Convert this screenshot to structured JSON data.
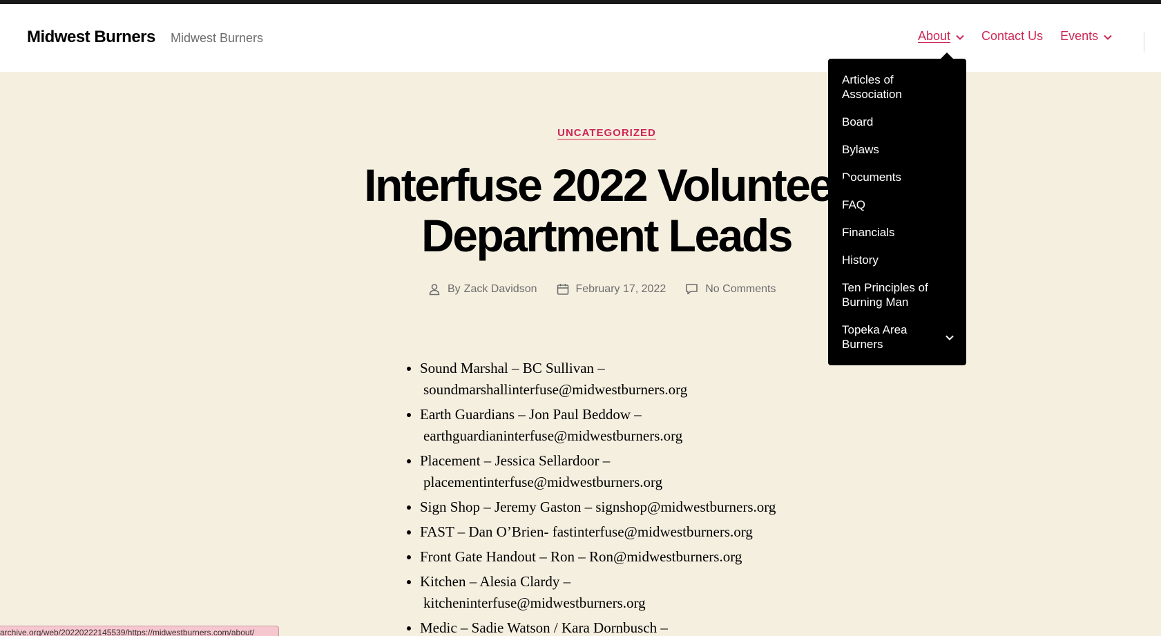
{
  "site": {
    "title": "Midwest Burners",
    "description": "Midwest Burners"
  },
  "nav": {
    "items": [
      {
        "label": "About",
        "has_submenu": true
      },
      {
        "label": "Contact Us",
        "has_submenu": false
      },
      {
        "label": "Events",
        "has_submenu": true
      }
    ]
  },
  "about_submenu": {
    "items": [
      {
        "label": "Articles of Association"
      },
      {
        "label": "Board"
      },
      {
        "label": "Bylaws"
      },
      {
        "label": "Documents"
      },
      {
        "label": "FAQ"
      },
      {
        "label": "Financials"
      },
      {
        "label": "History"
      },
      {
        "label": "Ten Principles of Burning Man"
      },
      {
        "label": "Topeka Area Burners"
      }
    ]
  },
  "post": {
    "category": "UNCATEGORIZED",
    "title_line1": "Interfuse 2022 Volunteer",
    "title_line2": "Department Leads",
    "author_prefix": "By",
    "author": "Zack Davidson",
    "date": "February 17, 2022",
    "comments": "No Comments"
  },
  "leads": [
    {
      "text": "Sound Marshal – BC Sullivan –",
      "email": "soundmarshallinterfuse@midwestburners.org"
    },
    {
      "text": "Earth Guardians – Jon Paul Beddow –",
      "email": "earthguardianinterfuse@midwestburners.org"
    },
    {
      "text": "Placement – Jessica Sellardoor –",
      "email": "placementinterfuse@midwestburners.org"
    },
    {
      "text": "Sign Shop – Jeremy Gaston –",
      "email": "signshop@midwestburners.org"
    },
    {
      "text": "FAST – Dan O’Brien-",
      "email": "fastinterfuse@midwestburners.org"
    },
    {
      "text": "Front Gate Handout – Ron –",
      "email": "Ron@midwestburners.org"
    },
    {
      "text": "Kitchen – Alesia Clardy –",
      "email": "kitcheninterfuse@midwestburners.org"
    },
    {
      "text": "Medic – Sadie Watson / Kara Dornbusch –",
      "email": ""
    }
  ],
  "status_bar": {
    "url": "archive.org/web/20220222145539/https://midwestburners.com/about/"
  },
  "colors": {
    "accent": "#cd2653",
    "background": "#f5efe0",
    "header": "#ffffff",
    "submenu": "#000000"
  }
}
